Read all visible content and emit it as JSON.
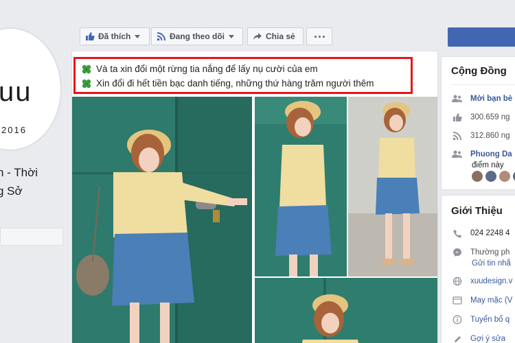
{
  "profile": {
    "brand": "uu",
    "year": "2016",
    "name_line1": "n - Thời",
    "name_line2": "g Sở"
  },
  "action_bar": {
    "like_label": "Đã thích",
    "follow_label": "Đang theo dõi",
    "share_label": "Chia sẻ"
  },
  "post": {
    "caption_lines": [
      "Và ta xin đổi một rừng tia nắng để lấy nụ cười của em",
      "Xin đổi đi hết tiền bạc danh tiếng, những thứ hàng trăm người thêm"
    ]
  },
  "community": {
    "title": "Cộng Đồng",
    "invite": "Mời bạn bè",
    "likes": "300.659 ng",
    "follows": "312.860 ng",
    "friend_name": "Phuong Da",
    "friend_suffix": "điểm này"
  },
  "about": {
    "title": "Giới Thiệu",
    "phone": "024 2248 4",
    "response": "Thường ph",
    "message": "Gửi tin nhắ",
    "website": "xuudesign.v",
    "category": "May mặc (V",
    "jobs": "Tuyển bổ q",
    "suggest": "Gợi ý sửa"
  },
  "colors": {
    "accent": "#4267b2",
    "highlight_border": "#e8141b",
    "link": "#385898",
    "teal_wall": "#2f7d6e"
  }
}
